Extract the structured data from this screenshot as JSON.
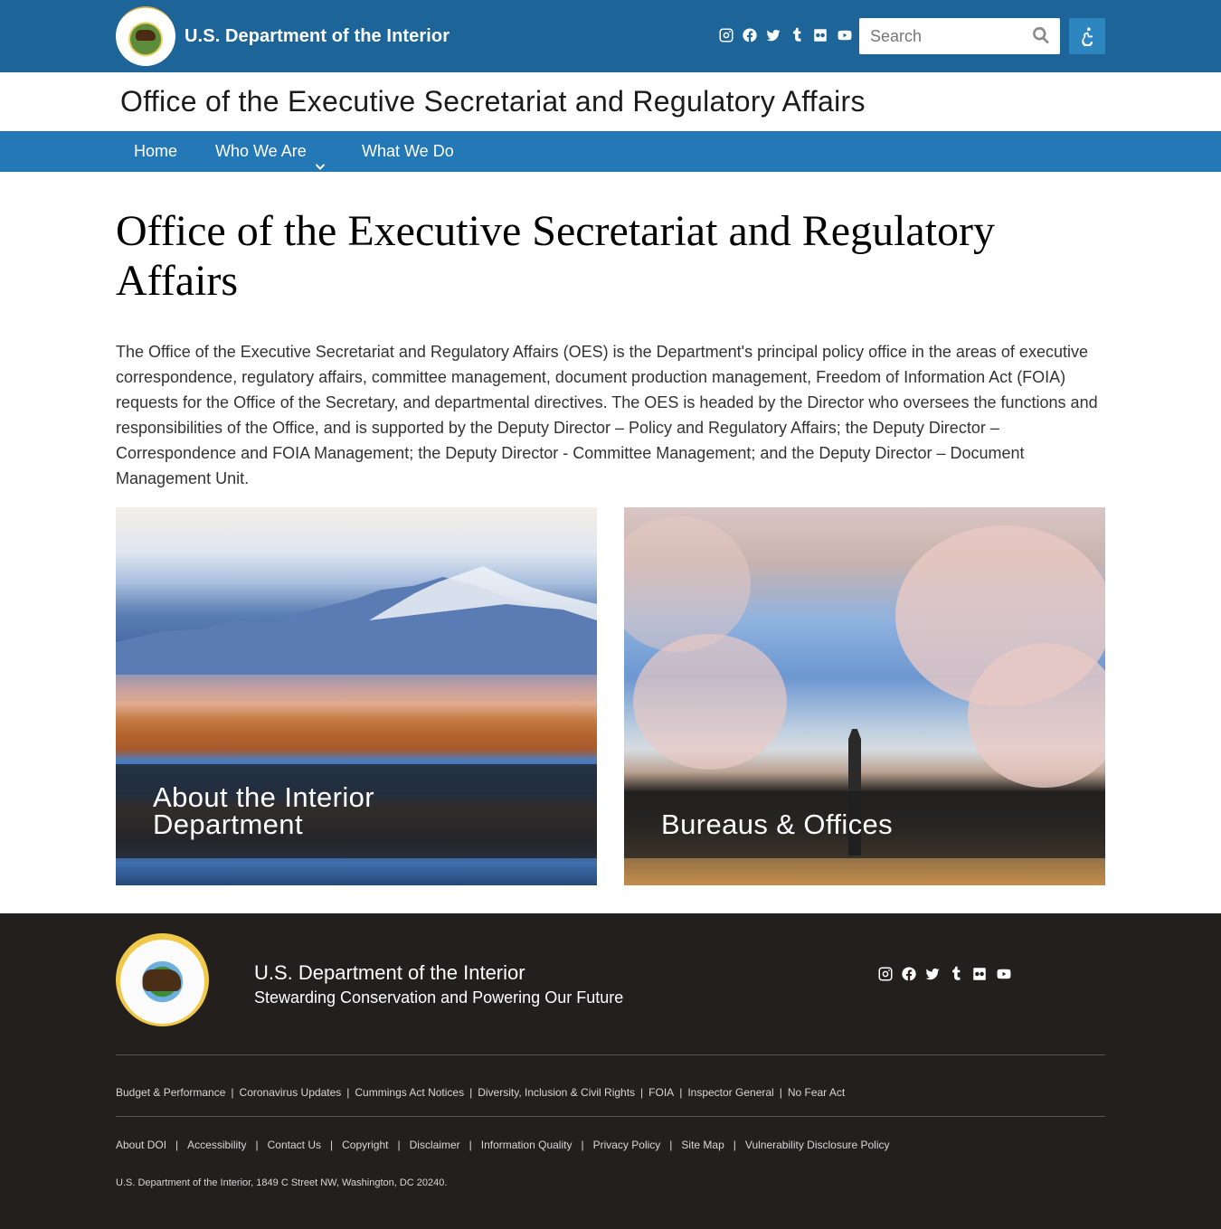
{
  "header": {
    "brand_name": "U.S. Department of the Interior",
    "search_placeholder": "Search",
    "socials": [
      "instagram-icon",
      "facebook-icon",
      "twitter-icon",
      "tumblr-icon",
      "flickr-icon",
      "youtube-icon"
    ],
    "colors": {
      "topbar": "#1d6499",
      "nav": "#2378b5",
      "accessibility_button": "#2e86c1"
    }
  },
  "office": {
    "title": "Office of the Executive Secretariat and Regulatory Affairs"
  },
  "nav": {
    "items": [
      {
        "label": "Home"
      },
      {
        "label": "Who We Are",
        "has_dropdown": true
      },
      {
        "label": "What We Do"
      }
    ]
  },
  "main": {
    "title": "Office of the Executive Secretariat and Regulatory Affairs",
    "intro": "The Office of the Executive Secretariat and Regulatory Affairs (OES) is the Department's principal policy office in the areas of executive correspondence, regulatory affairs, committee management, document production management, Freedom of Information Act (FOIA) requests for the Office of the Secretary, and departmental directives. The OES is headed by the Director who oversees the functions and responsibilities of the Office, and is supported by the Deputy Director – Policy and Regulatory Affairs; the Deputy Director – Correspondence and FOIA Management; the Deputy Director - Committee Management; and the Deputy Director – Document Management Unit.",
    "cards": [
      {
        "title_line1": "About the Interior",
        "title_line2": "Department"
      },
      {
        "title_line1": "Bureaus & Offices"
      }
    ]
  },
  "footer": {
    "name": "U.S. Department of the Interior",
    "tagline": "Stewarding Conservation and Powering Our Future",
    "links_row1": [
      "Budget & Performance",
      "Coronavirus Updates",
      "Cummings Act Notices",
      "Diversity, Inclusion & Civil Rights",
      "FOIA",
      "Inspector General",
      "No Fear Act"
    ],
    "links_row2": [
      "About DOI",
      "Accessibility",
      "Contact Us",
      "Copyright",
      "Disclaimer",
      "Information Quality",
      "Privacy Policy",
      "Site Map",
      "Vulnerability Disclosure Policy"
    ],
    "separator": "|",
    "address": "U.S. Department of the Interior, 1849 C Street NW, Washington, DC 20240.",
    "colors": {
      "background": "#231f1d"
    }
  }
}
